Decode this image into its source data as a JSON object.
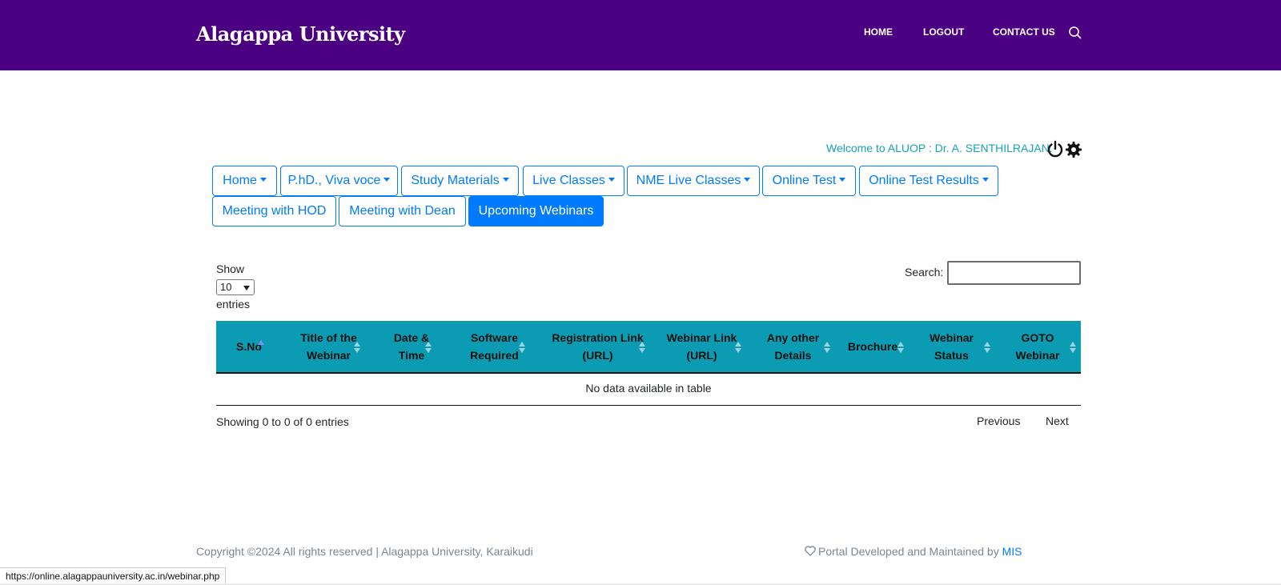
{
  "header": {
    "brand": "Alagappa University",
    "nav": [
      "HOME",
      "LOGOUT",
      "CONTACT US"
    ],
    "bg_color": "#4b0082"
  },
  "welcome": "Welcome to ALUOP : Dr. A. SENTHILRAJAN.",
  "menu": [
    {
      "label": "Home",
      "dropdown": true
    },
    {
      "label": "P.hD., Viva voce",
      "dropdown": true
    },
    {
      "label": "Study Materials",
      "dropdown": true
    },
    {
      "label": "Live Classes",
      "dropdown": true
    },
    {
      "label": "NME Live Classes",
      "dropdown": true
    },
    {
      "label": "Online Test",
      "dropdown": true
    },
    {
      "label": "Online Test Results",
      "dropdown": true
    },
    {
      "label": "Meeting with HOD",
      "dropdown": false
    },
    {
      "label": "Meeting with Dean",
      "dropdown": false
    },
    {
      "label": "Upcoming Webinars",
      "dropdown": false,
      "active": true
    }
  ],
  "table_controls": {
    "show": "Show",
    "entries_value": "10",
    "entries": "entries",
    "search_label": "Search:",
    "search_value": ""
  },
  "table": {
    "columns": [
      {
        "label": "S.No",
        "sort": "asc"
      },
      {
        "label": "Title of the Webinar",
        "sort": "both"
      },
      {
        "label": "Date & Time",
        "sort": "both"
      },
      {
        "label": "Software Required",
        "sort": "both"
      },
      {
        "label": "Registration Link (URL)",
        "sort": "both"
      },
      {
        "label": "Webinar Link (URL)",
        "sort": "both"
      },
      {
        "label": "Any other Details",
        "sort": "both"
      },
      {
        "label": "Brochure",
        "sort": "both"
      },
      {
        "label": "Webinar Status",
        "sort": "both"
      },
      {
        "label": "GOTO Webinar",
        "sort": "both"
      }
    ],
    "rows": [],
    "empty_message": "No data available in table",
    "header_color": "#0b9cb3"
  },
  "pagination": {
    "info": "Showing 0 to 0 of 0 entries",
    "previous": "Previous",
    "next": "Next"
  },
  "footer": {
    "copyright": "Copyright ©2024 All rights reserved | Alagappa University, Karaikudi",
    "credit_prefix": "Portal Developed and Maintained by",
    "credit_link": "MIS"
  },
  "status_url": "https://online.alagappauniversity.ac.in/webinar.php"
}
